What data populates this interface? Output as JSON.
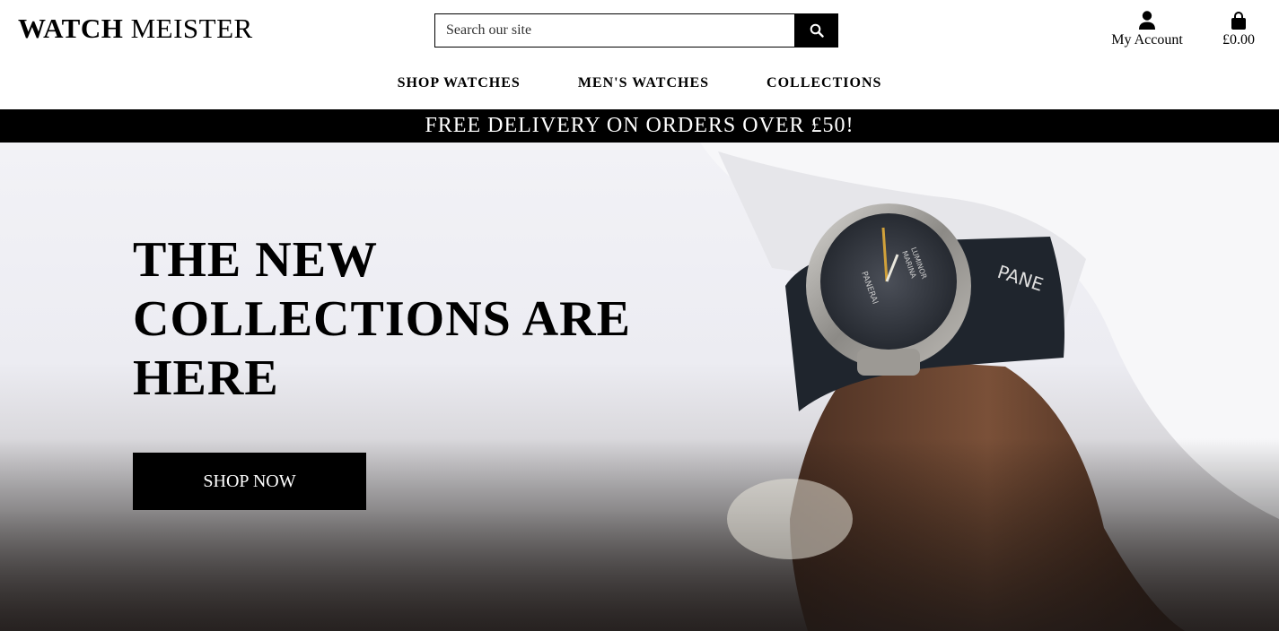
{
  "brand": {
    "name_bold": "WATCH",
    "name_rest": "MEISTER"
  },
  "search": {
    "placeholder": "Search our site",
    "value": "",
    "icon": "search-icon"
  },
  "account": {
    "label": "My Account",
    "icon": "user-icon"
  },
  "bag": {
    "total": "£0.00",
    "icon": "shopping-bag-icon"
  },
  "nav": {
    "items": [
      {
        "label": "SHOP WATCHES"
      },
      {
        "label": "MEN'S WATCHES"
      },
      {
        "label": "COLLECTIONS"
      }
    ]
  },
  "banner": {
    "text": "FREE DELIVERY ON ORDERS OVER £50!"
  },
  "hero": {
    "title_lines": [
      "THE NEW",
      "COLLECTIONS ARE",
      "HERE"
    ],
    "cta_label": "SHOP NOW",
    "watch_dial_brand": "PANERAI",
    "watch_dial_text": [
      "LUMINOR",
      "MARINA"
    ],
    "strap_text": "PANE"
  },
  "colors": {
    "primary": "#000000",
    "background": "#ffffff",
    "banner_text": "#ffffff"
  }
}
